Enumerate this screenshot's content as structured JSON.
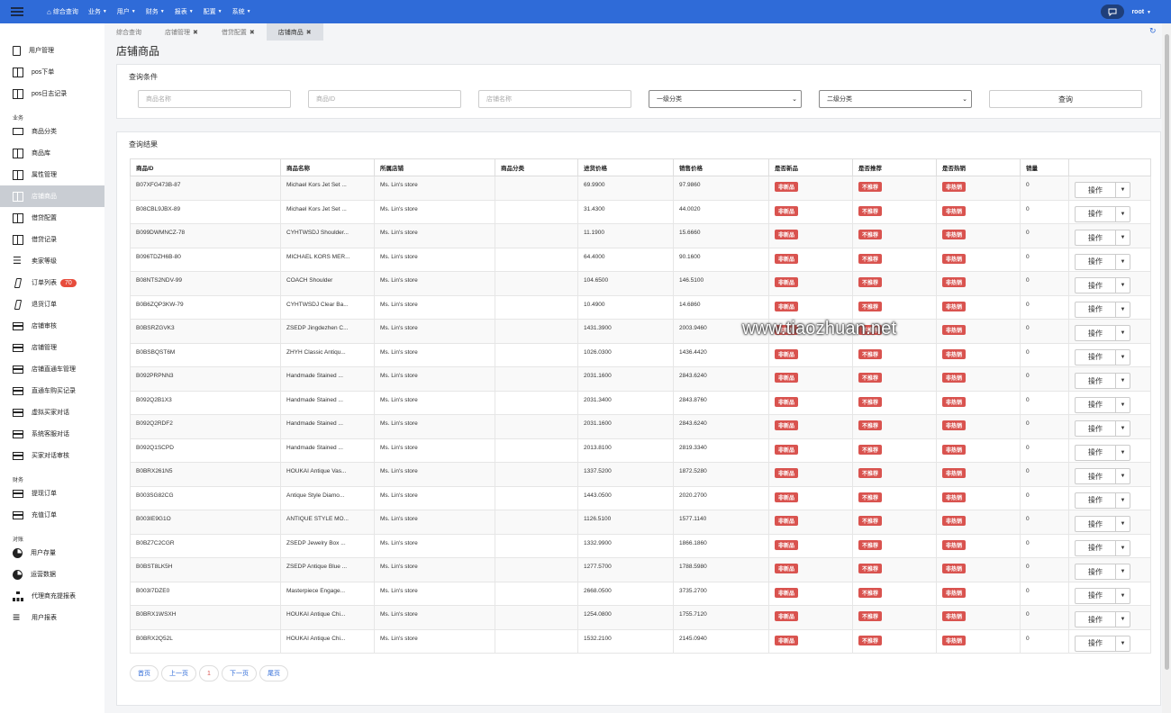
{
  "topbar": {
    "menu": [
      {
        "label": "综合查询",
        "home": true
      },
      {
        "label": "业务",
        "caret": true
      },
      {
        "label": "用户",
        "caret": true
      },
      {
        "label": "财务",
        "caret": true
      },
      {
        "label": "报表",
        "caret": true
      },
      {
        "label": "配置",
        "caret": true
      },
      {
        "label": "系统",
        "caret": true
      }
    ],
    "user": "root"
  },
  "sidebar": {
    "items": [
      {
        "type": "section",
        "label": ""
      },
      {
        "label": "用户管理",
        "icon": "document-icon"
      },
      {
        "label": "pos下单",
        "icon": "book-icon"
      },
      {
        "label": "pos日志记录",
        "icon": "book-icon"
      },
      {
        "type": "section",
        "label": "业务"
      },
      {
        "label": "商品分类",
        "icon": "laptop-icon"
      },
      {
        "label": "商品库",
        "icon": "book-icon"
      },
      {
        "label": "属性管理",
        "icon": "book-icon"
      },
      {
        "label": "店铺商品",
        "icon": "book-icon",
        "active": true
      },
      {
        "label": "借贷配置",
        "icon": "book-icon"
      },
      {
        "label": "借贷记录",
        "icon": "book-icon"
      },
      {
        "label": "卖家等级",
        "icon": "list-icon"
      },
      {
        "label": "订单列表",
        "icon": "mobile-icon",
        "badge": "70"
      },
      {
        "label": "退货订单",
        "icon": "mobile-icon"
      },
      {
        "label": "店铺审核",
        "icon": "card-icon"
      },
      {
        "label": "店铺管理",
        "icon": "card-icon"
      },
      {
        "label": "店铺直通车管理",
        "icon": "card-icon"
      },
      {
        "label": "直通车购买记录",
        "icon": "card-icon"
      },
      {
        "label": "虚拟买家对话",
        "icon": "card-icon"
      },
      {
        "label": "系统客服对话",
        "icon": "card-icon"
      },
      {
        "label": "买家对话审核",
        "icon": "card-icon"
      },
      {
        "type": "section",
        "label": "财务"
      },
      {
        "label": "提现订单",
        "icon": "card-icon"
      },
      {
        "label": "充值订单",
        "icon": "card-icon"
      },
      {
        "type": "section",
        "label": "对账"
      },
      {
        "label": "用户存量",
        "icon": "pie-chart-icon"
      },
      {
        "label": "运营数据",
        "icon": "pie-chart-icon"
      },
      {
        "label": "代理商充提报表",
        "icon": "sitemap-icon"
      },
      {
        "label": "用户报表",
        "icon": "align-left-icon"
      }
    ]
  },
  "tabs": [
    {
      "label": "综合查询",
      "closable": false
    },
    {
      "label": "店铺管理",
      "closable": true
    },
    {
      "label": "借贷配置",
      "closable": true
    },
    {
      "label": "店铺商品",
      "closable": true,
      "active": true
    }
  ],
  "page_title": "店铺商品",
  "query": {
    "title": "查询条件",
    "product_name_placeholder": "商品名称",
    "product_id_placeholder": "商品ID",
    "store_name_placeholder": "店铺名称",
    "category1": "一级分类",
    "category2": "二级分类",
    "search_label": "查询"
  },
  "results": {
    "title": "查询结果",
    "columns": [
      "商品ID",
      "商品名称",
      "所属店铺",
      "商品分类",
      "进货价格",
      "销售价格",
      "是否新品",
      "是否推荐",
      "是否热销",
      "销量",
      ""
    ],
    "badges": {
      "new": "非新品",
      "recommend": "不推荐",
      "hot": "非热销"
    },
    "op_label": "操作",
    "rows": [
      {
        "id": "B07XFG473B-87",
        "name": "Michael Kors Jet Set ...",
        "store": "Ms. Lin's store",
        "category": "",
        "cost": "69.9900",
        "price": "97.9860",
        "sales": "0"
      },
      {
        "id": "B08CBL9JBX-89",
        "name": "Michael Kors Jet Set ...",
        "store": "Ms. Lin's store",
        "category": "",
        "cost": "31.4300",
        "price": "44.0020",
        "sales": "0"
      },
      {
        "id": "B099DWMNCZ-78",
        "name": "CYHTWSDJ Shoulder...",
        "store": "Ms. Lin's store",
        "category": "",
        "cost": "11.1900",
        "price": "15.6660",
        "sales": "0"
      },
      {
        "id": "B096TDZH6B-80",
        "name": "MICHAEL KORS MER...",
        "store": "Ms. Lin's store",
        "category": "",
        "cost": "64.4000",
        "price": "90.1600",
        "sales": "0"
      },
      {
        "id": "B08NTS2NDV-99",
        "name": "COACH Shoulder",
        "store": "Ms. Lin's store",
        "category": "",
        "cost": "104.6500",
        "price": "146.5100",
        "sales": "0"
      },
      {
        "id": "B0B6ZQP3KW-79",
        "name": "CYHTWSDJ Clear Ba...",
        "store": "Ms. Lin's store",
        "category": "",
        "cost": "10.4900",
        "price": "14.6860",
        "sales": "0"
      },
      {
        "id": "B0BSRZGVK3",
        "name": "ZSEDP Jingdezhen C...",
        "store": "Ms. Lin's store",
        "category": "",
        "cost": "1431.3900",
        "price": "2003.9460",
        "sales": "0"
      },
      {
        "id": "B0BSBQST6M",
        "name": "ZHYH Classic Antiqu...",
        "store": "Ms. Lin's store",
        "category": "",
        "cost": "1026.0300",
        "price": "1436.4420",
        "sales": "0"
      },
      {
        "id": "B092PRPNN3",
        "name": "Handmade Stained ...",
        "store": "Ms. Lin's store",
        "category": "",
        "cost": "2031.1600",
        "price": "2843.6240",
        "sales": "0"
      },
      {
        "id": "B092Q2B1X3",
        "name": "Handmade Stained ...",
        "store": "Ms. Lin's store",
        "category": "",
        "cost": "2031.3400",
        "price": "2843.8760",
        "sales": "0"
      },
      {
        "id": "B092Q2RDF2",
        "name": "Handmade Stained ...",
        "store": "Ms. Lin's store",
        "category": "",
        "cost": "2031.1600",
        "price": "2843.6240",
        "sales": "0"
      },
      {
        "id": "B092Q1SCPD",
        "name": "Handmade Stained ...",
        "store": "Ms. Lin's store",
        "category": "",
        "cost": "2013.8100",
        "price": "2819.3340",
        "sales": "0"
      },
      {
        "id": "B0BRX261N5",
        "name": "HOUKAI Antique Vas...",
        "store": "Ms. Lin's store",
        "category": "",
        "cost": "1337.5200",
        "price": "1872.5280",
        "sales": "0"
      },
      {
        "id": "B003SG82CG",
        "name": "Antique Style Diamo...",
        "store": "Ms. Lin's store",
        "category": "",
        "cost": "1443.0500",
        "price": "2020.2700",
        "sales": "0"
      },
      {
        "id": "B003IE9G1O",
        "name": "ANTIQUE STYLE MO...",
        "store": "Ms. Lin's store",
        "category": "",
        "cost": "1126.5100",
        "price": "1577.1140",
        "sales": "0"
      },
      {
        "id": "B0BZ7C2CGR",
        "name": "ZSEDP Jewelry Box ...",
        "store": "Ms. Lin's store",
        "category": "",
        "cost": "1332.9900",
        "price": "1866.1860",
        "sales": "0"
      },
      {
        "id": "B0BST8LK5H",
        "name": "ZSEDP Antique Blue ...",
        "store": "Ms. Lin's store",
        "category": "",
        "cost": "1277.5700",
        "price": "1788.5980",
        "sales": "0"
      },
      {
        "id": "B003I7DZE0",
        "name": "Masterpiece Engage...",
        "store": "Ms. Lin's store",
        "category": "",
        "cost": "2668.0500",
        "price": "3735.2700",
        "sales": "0"
      },
      {
        "id": "B0BRX1WSXH",
        "name": "HOUKAI Antique Chi...",
        "store": "Ms. Lin's store",
        "category": "",
        "cost": "1254.0800",
        "price": "1755.7120",
        "sales": "0"
      },
      {
        "id": "B0BRX2Q52L",
        "name": "HOUKAI Antique Chi...",
        "store": "Ms. Lin's store",
        "category": "",
        "cost": "1532.2100",
        "price": "2145.0940",
        "sales": "0"
      }
    ]
  },
  "pager": {
    "first": "首页",
    "prev": "上一页",
    "current": "1",
    "next": "下一页",
    "last": "尾页"
  },
  "watermark": "www.tiaozhuan.net"
}
